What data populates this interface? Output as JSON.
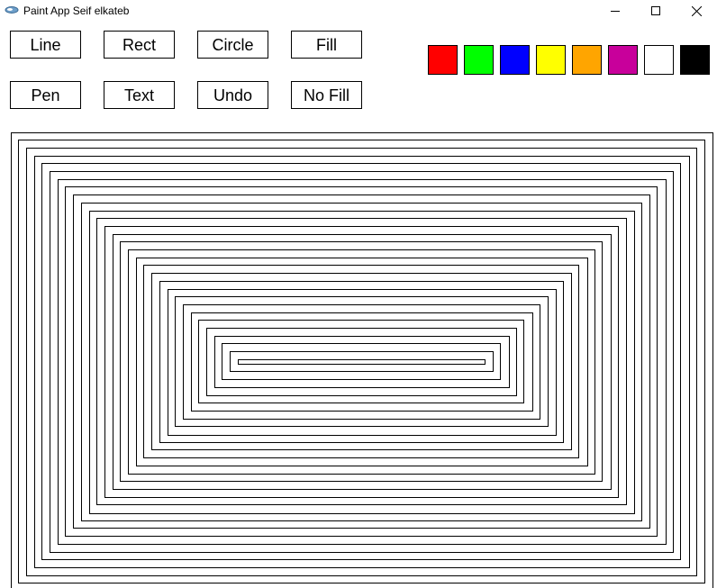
{
  "window": {
    "title": "Paint App Seif elkateb",
    "icon": "app-icon"
  },
  "tools": [
    {
      "id": "line",
      "label": "Line"
    },
    {
      "id": "rect",
      "label": "Rect"
    },
    {
      "id": "circle",
      "label": "Circle"
    },
    {
      "id": "fill",
      "label": "Fill"
    },
    {
      "id": "pen",
      "label": "Pen"
    },
    {
      "id": "text",
      "label": "Text"
    },
    {
      "id": "undo",
      "label": "Undo"
    },
    {
      "id": "no-fill",
      "label": "No Fill"
    }
  ],
  "palette": [
    {
      "name": "red",
      "color": "#ff0000"
    },
    {
      "name": "green",
      "color": "#00ff00"
    },
    {
      "name": "blue",
      "color": "#0000ff"
    },
    {
      "name": "yellow",
      "color": "#ffff00"
    },
    {
      "name": "orange",
      "color": "#ffa500"
    },
    {
      "name": "magenta",
      "color": "#c8009b"
    },
    {
      "name": "white",
      "color": "#ffffff"
    },
    {
      "name": "black",
      "color": "#000000"
    }
  ],
  "canvas": {
    "stroke_color": "#000000",
    "nested_rectangle_count": 30
  }
}
